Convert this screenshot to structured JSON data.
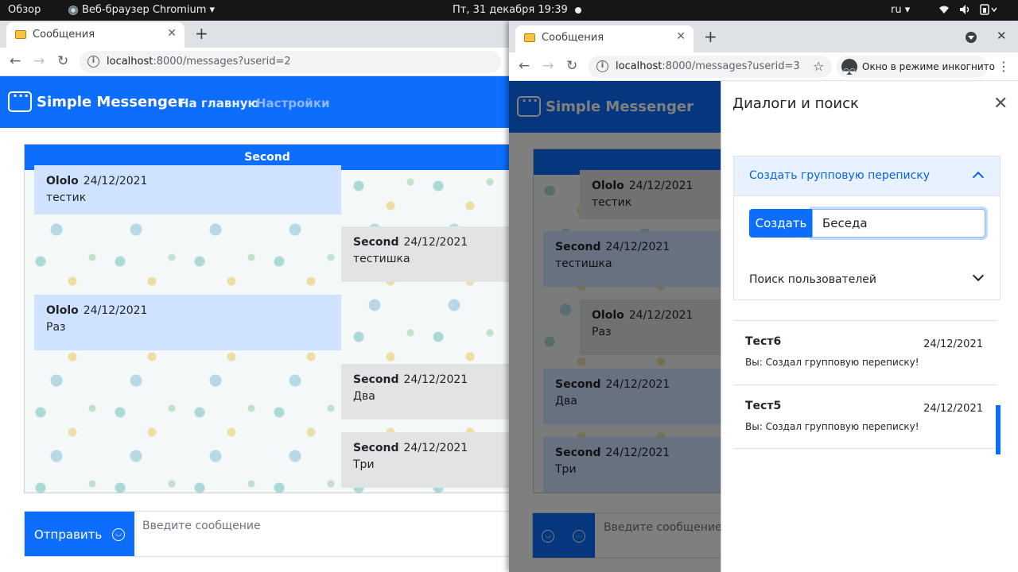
{
  "topbar": {
    "overview": "Обзор",
    "app": "Веб-браузер Chromium ▾",
    "clock": "Пт, 31 декабря  19:39",
    "lang": "ru ▾"
  },
  "left_window": {
    "tab_title": "Сообщения",
    "tab_close": "✕",
    "new_tab": "+",
    "url_host": "localhost",
    "url_rest": ":8000/messages?userid=2",
    "back": "←",
    "forward": "→",
    "reload": "↻",
    "app": {
      "brand": "Simple Messenger",
      "nav_home": "На главную",
      "nav_settings": "Настройки",
      "chat_title": "Second",
      "messages": [
        {
          "author": "Ololo",
          "date": "24/12/2021",
          "text": "тестик",
          "own": true
        },
        {
          "author": "Second",
          "date": "24/12/2021",
          "text": "тестишка",
          "own": false
        },
        {
          "author": "Ololo",
          "date": "24/12/2021",
          "text": "Раз",
          "own": true
        },
        {
          "author": "Second",
          "date": "24/12/2021",
          "text": "Два",
          "own": false
        },
        {
          "author": "Second",
          "date": "24/12/2021",
          "text": "Три",
          "own": false
        }
      ],
      "send_label": "Отправить",
      "message_placeholder": "Введите сообщение"
    }
  },
  "right_window": {
    "tab_title": "Сообщения",
    "tab_close": "✕",
    "new_tab": "+",
    "window_close": "✕",
    "url_host": "localhost",
    "url_rest": ":8000/messages?userid=3",
    "incognito_label": "Окно в режиме инкогнито",
    "back": "←",
    "forward": "→",
    "reload": "↻",
    "star": "☆",
    "app": {
      "brand": "Simple Messenger",
      "messages": [
        {
          "author": "Ololo",
          "date": "24/12/2021",
          "text": "тестик",
          "own": false
        },
        {
          "author": "Second",
          "date": "24/12/2021",
          "text": "тестишка",
          "own": true
        },
        {
          "author": "Ololo",
          "date": "24/12/2021",
          "text": "Раз",
          "own": false
        },
        {
          "author": "Second",
          "date": "24/12/2021",
          "text": "Два",
          "own": true
        },
        {
          "author": "Second",
          "date": "24/12/2021",
          "text": "Три",
          "own": true
        }
      ],
      "message_placeholder": "Введите сообщение"
    },
    "offcanvas": {
      "title": "Диалоги и поиск",
      "close": "✕",
      "group_header": "Создать групповую переписку",
      "create_label": "Создать",
      "group_name_value": "Беседа",
      "search_header": "Поиск пользователей",
      "conversations": [
        {
          "name": "Тест6",
          "date": "24/12/2021",
          "last": "Вы: Создал групповую переписку!"
        },
        {
          "name": "Тест5",
          "date": "24/12/2021",
          "last": "Вы: Создал групповую переписку!"
        }
      ]
    }
  }
}
